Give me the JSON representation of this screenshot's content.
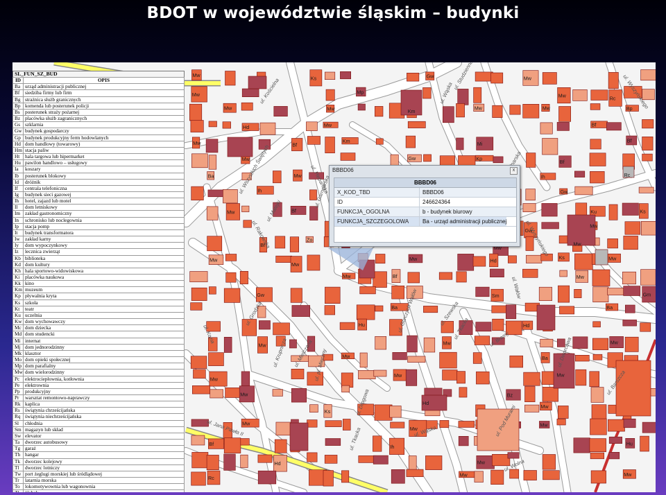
{
  "title": "BDOT w województwie śląskim – budynki",
  "colors": {
    "building": "#e8643c",
    "building_dark": "#a84452",
    "building_light": "#f0a080",
    "outline": "#7a1010",
    "road": "#ffffff",
    "road_edge": "#9a9a9a",
    "main_road": "#ffff66",
    "rail": "#c83030",
    "background": "#f4f4f4"
  },
  "legend_table": {
    "name": "SL_FUN_SZ_BUD",
    "col_id": "ID",
    "col_desc": "OPIS",
    "rows": [
      [
        "Ba",
        "urząd administracji publicznej"
      ],
      [
        "Bf",
        "siedziba firmy lub firm"
      ],
      [
        "Bg",
        "strażnica służb granicznych"
      ],
      [
        "Bp",
        "komenda lub posterunek policji"
      ],
      [
        "Bs",
        "posterunek straży pożarnej"
      ],
      [
        "Bz",
        "placówka służb zagranicznych"
      ],
      [
        "Gs",
        "szklarnia"
      ],
      [
        "Gw",
        "budynek gospodarczy"
      ],
      [
        "Gp",
        "budynek produkcyjny ferm hodowlanych"
      ],
      [
        "Hd",
        "dom handlowy (towarowy)"
      ],
      [
        "Hm",
        "stacja paliw"
      ],
      [
        "Ht",
        "hala targowa lub hipermarket"
      ],
      [
        "Hu",
        "pawilon handlowo – usługowy"
      ],
      [
        "Ia",
        "koszary"
      ],
      [
        "Ib",
        "posterunek blokowy"
      ],
      [
        "Id",
        "dróżnik"
      ],
      [
        "If",
        "centrala telefoniczna"
      ],
      [
        "Ig",
        "budynek sieci gazowej"
      ],
      [
        "Ih",
        "hotel, zajazd lub motel"
      ],
      [
        "Il",
        "dom letniskowy"
      ],
      [
        "Im",
        "zakład gastronomiczny"
      ],
      [
        "In",
        "schronisko lub noclegownia"
      ],
      [
        "Ip",
        "stacja pomp"
      ],
      [
        "It",
        "budynek transformatora"
      ],
      [
        "Iw",
        "zakład karny"
      ],
      [
        "Iy",
        "dom wypoczynkowy"
      ],
      [
        "Iz",
        "lecznica zwierząt"
      ],
      [
        "Kb",
        "biblioteka"
      ],
      [
        "Kd",
        "dom kultury"
      ],
      [
        "Kh",
        "hala sportowo-widowiskowa"
      ],
      [
        "Ki",
        "placówka naukowa"
      ],
      [
        "Kk",
        "kino"
      ],
      [
        "Km",
        "muzeum"
      ],
      [
        "Kp",
        "pływalnia kryta"
      ],
      [
        "Ks",
        "szkoła"
      ],
      [
        "Kt",
        "teatr"
      ],
      [
        "Ku",
        "uczelnia"
      ],
      [
        "Kw",
        "dom wychowawczy"
      ],
      [
        "Mc",
        "dom dziecka"
      ],
      [
        "Md",
        "dom studencki"
      ],
      [
        "Mi",
        "internat"
      ],
      [
        "Mj",
        "dom jednorodzinny"
      ],
      [
        "Mk",
        "klasztor"
      ],
      [
        "Mo",
        "dom opieki społecznej"
      ],
      [
        "Mp",
        "dom parafialny"
      ],
      [
        "Mw",
        "dom wielorodzinny"
      ],
      [
        "Pc",
        "elektrociepłownia, kotłownia"
      ],
      [
        "Pe",
        "elektrownia"
      ],
      [
        "Pp",
        "produkcyjny"
      ],
      [
        "Pr",
        "warsztat remontowo-naprawczy"
      ],
      [
        "Rk",
        "kaplica"
      ],
      [
        "Rs",
        "świątynia chrześcijańska"
      ],
      [
        "Rq",
        "świątynia niechrześcijańska"
      ],
      [
        "Sl",
        "chłodnia"
      ],
      [
        "Sm",
        "magazyn lub skład"
      ],
      [
        "Sw",
        "elevator"
      ],
      [
        "Ta",
        "dworzec autobusowy"
      ],
      [
        "Tg",
        "garaż"
      ],
      [
        "Th",
        "hangar"
      ],
      [
        "Tk",
        "dworzec kolejowy"
      ],
      [
        "Tl",
        "dworzec lotniczy"
      ],
      [
        "Tw",
        "port żeglugi morskiej lub śródlądowej"
      ],
      [
        "Tr",
        "latarnia morska"
      ],
      [
        "To",
        "lokomotywownia lub wagonownia"
      ],
      [
        "Zl",
        "żłobek"
      ],
      [
        "Zo",
        "ośrodek zdrowia"
      ],
      [
        "Zs",
        "szpital"
      ],
      [
        "Zt",
        "sanatorium"
      ]
    ]
  },
  "popup": {
    "window_title": "BBBD06",
    "close": "x",
    "header": "BBBD06",
    "rows": [
      {
        "key": "X_KOD_TBD",
        "value": "BBBD06"
      },
      {
        "key": "ID",
        "value": "246624364"
      },
      {
        "key": "FUNKCJA_OGOLNA",
        "value": "b - budynek biurowy"
      },
      {
        "key": "FUNKCJA_SZCZEGOLOWA",
        "value": "Ba - urząd administracji publicznej"
      }
    ]
  },
  "street_names": [
    "ul. Kościelna",
    "ul. Wszystkich Świętych",
    "ul. Plebańska",
    "ul. Rakowska",
    "ul. Studzienna",
    "ul. Wyszyńskiego",
    "ul. Wyszyńskiego",
    "ul. Wałów",
    "ul. Bednarska",
    "ul. Garncarska",
    "ul. Kozia",
    "ul. Grodzka",
    "ul. Krupnicza",
    "ul. Mielczana",
    "ul. pl. Mieczny",
    "ul. Szewska",
    "ul. Tkacka",
    "ul. Bramy",
    "ul. Matejki",
    "ul. Drogowa",
    "ul. Wąska",
    "ul. Pod Murami",
    "ul. Barszcza",
    "ul. Dworcowa",
    "ul. Wolna",
    "ul. Jana Pawła II",
    "ul. Gorczych Wałów",
    "ul. Tkacka",
    "ul. Wąska"
  ],
  "building_labels": [
    "Ks",
    "Mw",
    "Mp",
    "Rc",
    "Mw",
    "Mw",
    "Bp",
    "Mw",
    "Mw",
    "Km",
    "Bf",
    "Gw",
    "Bf",
    "Mw",
    "Mw",
    "Rc",
    "Mw",
    "Gw",
    "Bf",
    "Mw",
    "Ks",
    "Tg",
    "Mw",
    "Zo",
    "Mw",
    "Mw",
    "Hd",
    "Mw",
    "Bf",
    "Mw",
    "Gw",
    "Sm",
    "Gm",
    "Ba",
    "Ba",
    "Hu",
    "Hd",
    "Mw",
    "Mw",
    "Mw",
    "Mw",
    "Ba",
    "Mw",
    "Mw",
    "Mw",
    "Mw",
    "Bz",
    "Ks",
    "Mw",
    "Mw",
    "Mw",
    "Mw",
    "Bf",
    "Ih",
    "Hu",
    "Hd",
    "Mw",
    "Rc",
    "Mw",
    "Mw",
    "Hd",
    "Mw",
    "Gw",
    "Mw",
    "Mw",
    "Mw",
    "Km",
    "Mw",
    "Hd",
    "Bf",
    "Bf",
    "Mi",
    "Mw",
    "Kp",
    "Ba",
    "Mw",
    "Ih",
    "Ih",
    "Mw",
    "Mw",
    "Ks",
    "Ku",
    "Mw",
    "Gw",
    "Bf",
    "Mw",
    "Mw",
    "Mw",
    "Ks",
    "Mw"
  ]
}
